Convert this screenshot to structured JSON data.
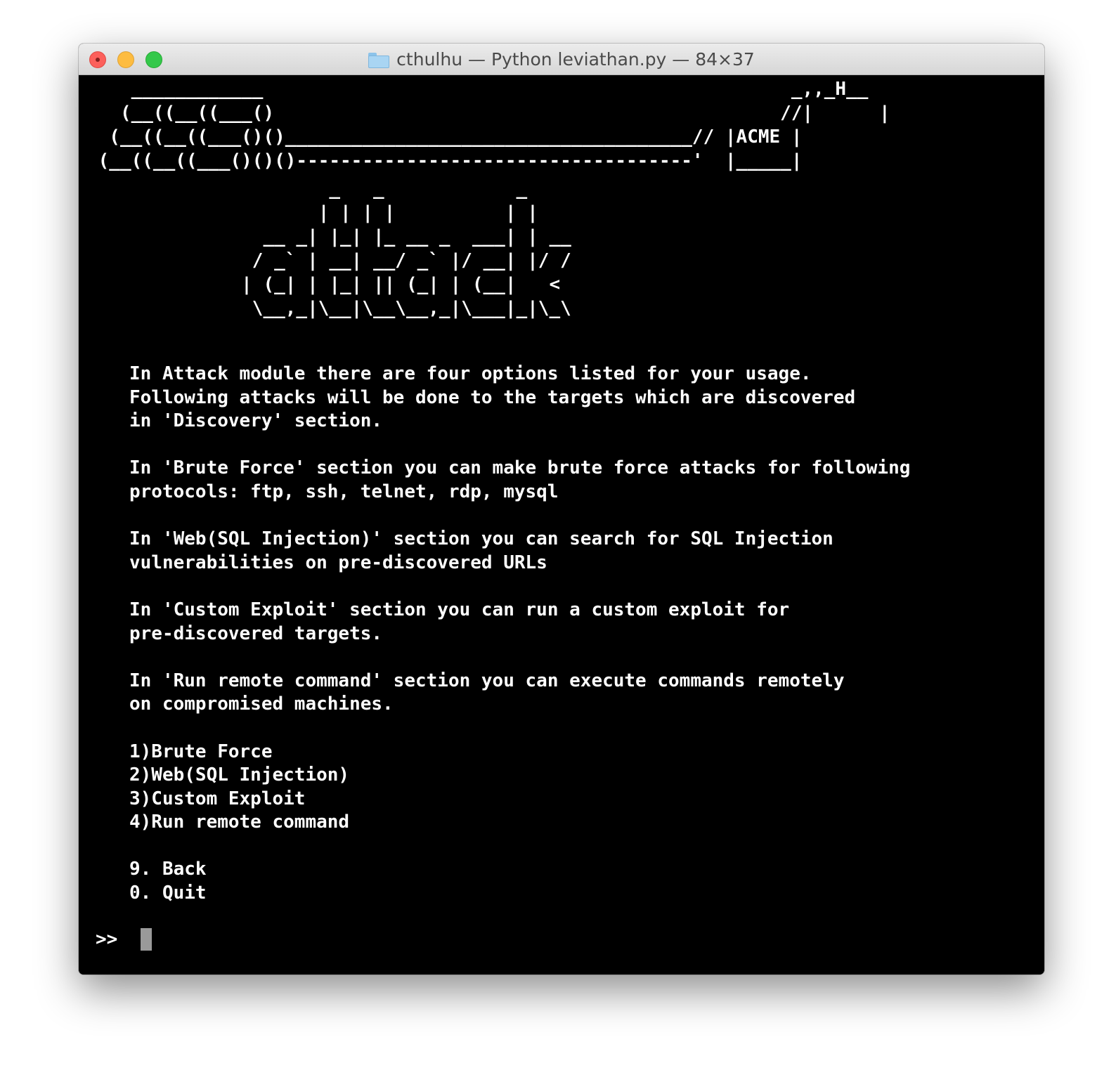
{
  "window": {
    "title": "cthulhu — Python leviathan.py — 84×37",
    "folder_icon": "folder-icon"
  },
  "terminal": {
    "ascii_ship": "    ____________                                                _,,_H__\n   (__((__((___()                                              //|      |\n  (__((__((___()()_____________________________________// |ACME |\n (__((__((___()()()------------------------------------'  |_____|",
    "ascii_logo": "                      _   _            _\n                     | | | |          | |\n                __ _| |_| |_ __ _  ___| | __\n               / _` | __| __/ _` |/ __| |/ /\n              | (_| | |_| || (_| | (__|   <\n               \\__,_|\\__|\\__\\__,_|\\___|_|\\_\\",
    "paragraphs": [
      "In Attack module there are four options listed for your usage.",
      "Following attacks will be done to the targets which are discovered",
      "in 'Discovery' section.",
      "",
      "In 'Brute Force' section you can make brute force attacks for following",
      "protocols: ftp, ssh, telnet, rdp, mysql",
      "",
      "In 'Web(SQL Injection)' section you can search for SQL Injection",
      "vulnerabilities on pre-discovered URLs",
      "",
      "In 'Custom Exploit' section you can run a custom exploit for",
      "pre-discovered targets.",
      "",
      "In 'Run remote command' section you can execute commands remotely",
      "on compromised machines.",
      ""
    ],
    "menu": [
      "1)Brute Force",
      "2)Web(SQL Injection)",
      "3)Custom Exploit",
      "4)Run remote command"
    ],
    "nav": [
      "9. Back",
      "0. Quit"
    ],
    "prompt": ">>"
  },
  "colors": {
    "terminal_bg": "#000000",
    "terminal_fg": "#ffffff",
    "cursor": "#9a9a9a",
    "close": "#fc605b",
    "minimize": "#fdbc40",
    "maximize": "#34c84a"
  }
}
